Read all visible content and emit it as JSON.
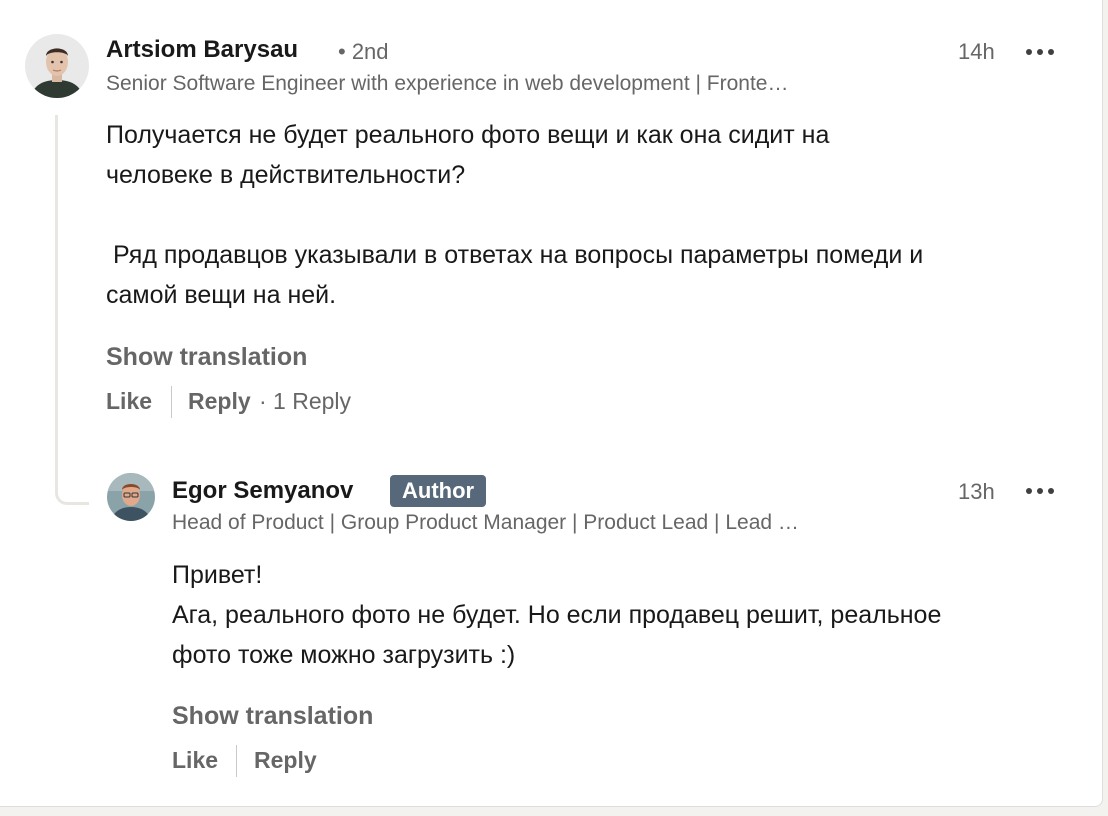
{
  "comment": {
    "author": {
      "name": "Artsiom Barysau",
      "degree": "• 2nd",
      "headline": "Senior Software Engineer with experience in web development | Fronte…"
    },
    "time": "14h",
    "text_paragraph_1": "Получается не будет реального фото вещи и как она сидит на\nчеловеке в действительности?",
    "text_paragraph_2": " Ряд продавцов указывали в ответах на вопросы параметры помеди и\nсамой вещи на ней.",
    "show_translation": "Show translation",
    "actions": {
      "like": "Like",
      "reply": "Reply",
      "replies_count": "· 1 Reply"
    }
  },
  "reply": {
    "author": {
      "name": "Egor Semyanov",
      "badge": "Author",
      "headline": "Head of Product | Group Product Manager | Product Lead | Lead …"
    },
    "time": "13h",
    "text": "Привет!\nАга, реального фото не будет. Но если продавец решит, реальное\nфото тоже можно загрузить :)",
    "show_translation": "Show translation",
    "actions": {
      "like": "Like",
      "reply": "Reply"
    }
  },
  "icons": {
    "more_options": "ellipsis-icon"
  },
  "colors": {
    "badge_bg": "#56687a",
    "secondary_text": "#666666",
    "primary_text": "#191919"
  }
}
